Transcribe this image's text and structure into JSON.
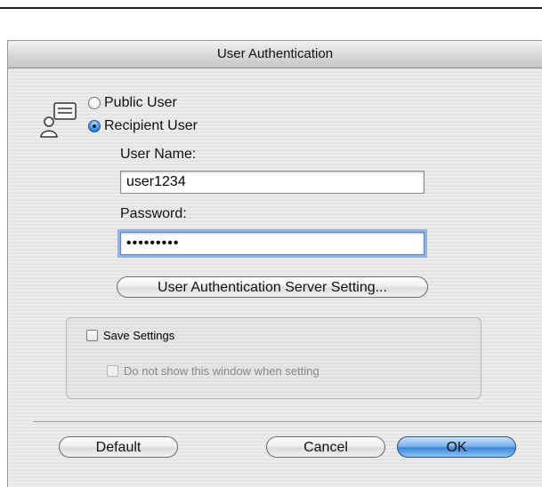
{
  "dialog": {
    "title": "User Authentication"
  },
  "user_type": {
    "public_label": "Public User",
    "recipient_label": "Recipient User",
    "selected": "Recipient User"
  },
  "fields": {
    "user_name_label": "User Name:",
    "user_name_value": "user1234",
    "password_label": "Password:",
    "password_value": "•••••••••"
  },
  "buttons": {
    "server_setting": "User Authentication Server Setting...",
    "default": "Default",
    "cancel": "Cancel",
    "ok": "OK"
  },
  "settings": {
    "save_label": "Save Settings",
    "save_checked": false,
    "do_not_show_label": "Do not show this window when setting",
    "do_not_show_checked": false
  }
}
